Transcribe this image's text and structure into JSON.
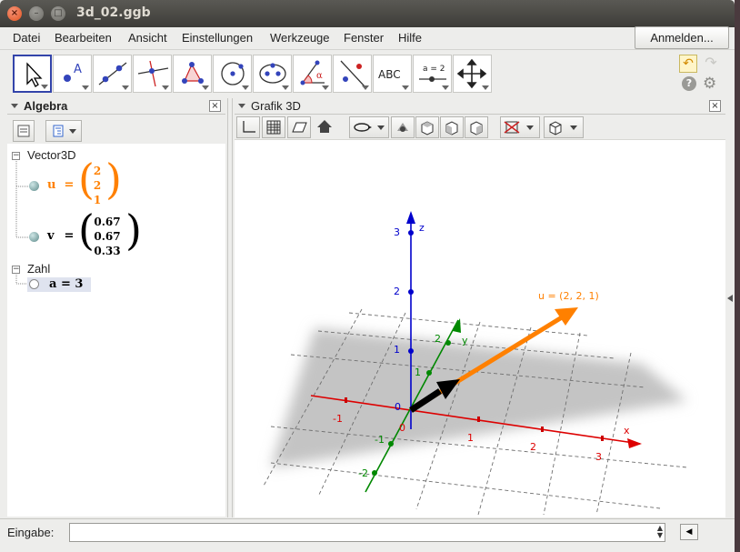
{
  "window": {
    "title": "3d_02.ggb"
  },
  "menu": [
    "Datei",
    "Bearbeiten",
    "Ansicht",
    "Einstellungen",
    "Werkzeuge",
    "Fenster",
    "Hilfe"
  ],
  "login_label": "Anmelden...",
  "tools": [
    {
      "icon": "move-arrow-icon"
    },
    {
      "icon": "point-icon",
      "label": "A"
    },
    {
      "icon": "line-through-points-icon"
    },
    {
      "icon": "perpendicular-line-icon"
    },
    {
      "icon": "polygon-icon"
    },
    {
      "icon": "circle-icon"
    },
    {
      "icon": "ellipse-icon"
    },
    {
      "icon": "angle-icon",
      "label": "α"
    },
    {
      "icon": "reflect-icon"
    },
    {
      "icon": "text-icon",
      "label": "ABC"
    },
    {
      "icon": "slider-icon",
      "label": "a = 2"
    },
    {
      "icon": "move-graphics-view-icon"
    }
  ],
  "algebra_panel": {
    "title": "Algebra",
    "categories": [
      {
        "name": "Vector3D",
        "items": [
          {
            "name": "u",
            "values": [
              "2",
              "2",
              "1"
            ],
            "color": "#ff8000"
          },
          {
            "name": "v",
            "values": [
              "0.67",
              "0.67",
              "0.33"
            ],
            "color": "#000000"
          }
        ]
      },
      {
        "name": "Zahl",
        "items": [
          {
            "text": "a = 3"
          }
        ]
      }
    ]
  },
  "graphics3d_panel": {
    "title": "Grafik 3D",
    "axis_labels": {
      "x": "x",
      "y": "y",
      "z": "z"
    },
    "x_ticks": [
      "-1",
      "1",
      "2",
      "3"
    ],
    "y_ticks": [
      "-2",
      "-1",
      "1",
      "2"
    ],
    "z_ticks": [
      "1",
      "2",
      "3"
    ],
    "origin_labels": [
      "0",
      "0"
    ],
    "vector_label": "u = (2, 2, 1)",
    "colors": {
      "x_axis": "#dd0000",
      "y_axis": "#008000",
      "z_axis": "#0000dd",
      "vector_u": "#ff8000",
      "vector_v": "#000000"
    }
  },
  "input_bar": {
    "label": "Eingabe:"
  }
}
